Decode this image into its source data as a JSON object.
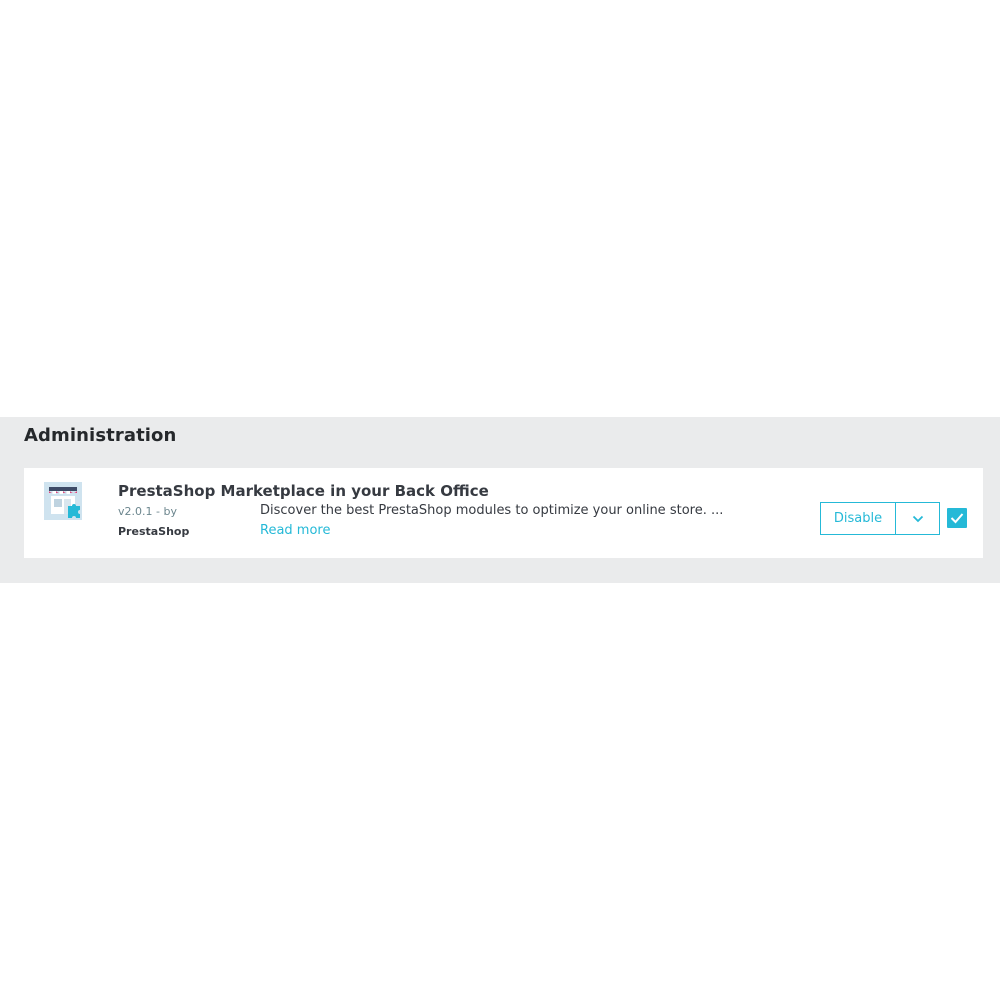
{
  "section": {
    "title": "Administration"
  },
  "module": {
    "name": "PrestaShop Marketplace in your Back Office",
    "version": "v2.0.1 - by",
    "author": "PrestaShop",
    "description": "Discover the best PrestaShop modules to optimize your online store. ...",
    "read_more": "Read more",
    "logo_icon": "store-puzzle-icon"
  },
  "actions": {
    "disable_label": "Disable",
    "dropdown_icon": "chevron-down-icon",
    "checkbox_checked": true
  },
  "colors": {
    "accent": "#25b9d7",
    "section_bg": "#eaebec",
    "text": "#363a41"
  }
}
